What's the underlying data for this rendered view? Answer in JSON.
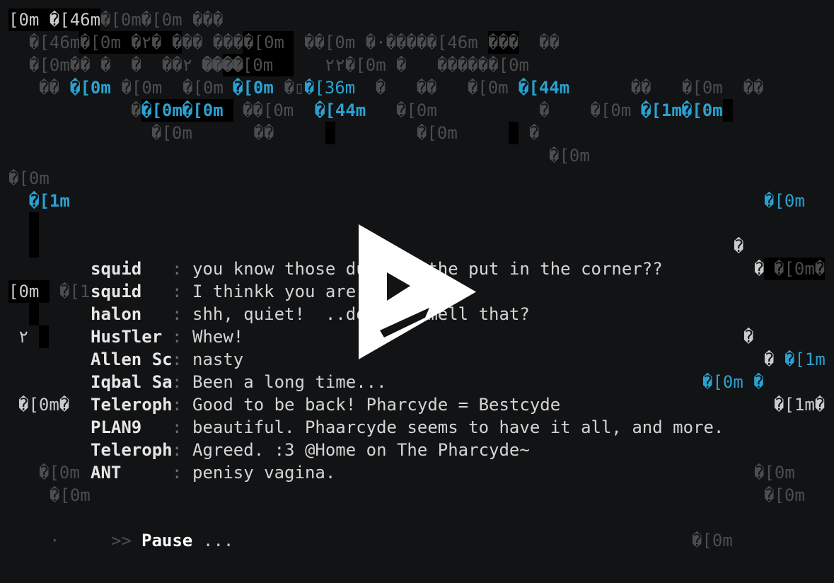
{
  "garble": {
    "r1a": "[0m �[46m",
    "r1b": "�[0m�[0m ���",
    "r2a": "�[46m",
    "r2b": "�[0m �٢� ��� ����[0m",
    "r2c": "��[0m �·�����[46m ",
    "r2d": "���",
    "r2e": "��",
    "r3a": "�[0m�� �  �  ��٢ ����",
    "r3b": "����[0m",
    "r3c": "٢٢�[0m �   ������[0m",
    "r4a": "�� ",
    "r4b": "�[0m",
    "r4c": " �[0m  �[0m ",
    "r4d": "�[0m",
    "r4e": " �▯",
    "r4f": "�[36m",
    "r4g": "  �   ��   �[0m ",
    "r4h": "�[44m",
    "r4i": "      ��   �[0m  ��",
    "r5a": "�",
    "r5b": "�[0m�[0m",
    "r5c": "��[0m  ",
    "r5d": "�[44m",
    "r5e": "�[0m          �    �[0m ",
    "r5f": "�[1m�[0m",
    "r6a": "�[0m      ��",
    "r6b": "�[0m",
    "r6c": "�",
    "r7a": "�[0m",
    "r8a": "�[0m",
    "r9a": "�[1m",
    "r9b": "�[0m",
    "r11a": "�",
    "r12a": "�",
    "r12b": "�[0m�",
    "r13a": "[0m",
    "r13b": "�[1",
    "r15a": "٢",
    "r15b": "�",
    "r16a": "� ",
    "r16b": "�[1m",
    "r17a": "�[0m �",
    "r18a": "�[0m�",
    "r18b": "�[1m�",
    "r20a": "�[0m",
    "r20b": "�[0m",
    "r21a": "�[0m",
    "r21b": "�[0m",
    "r23a": "·",
    "r23b": "�[0m"
  },
  "chat": [
    {
      "name": "squid",
      "message": "you know those dumbies the put in the corner??"
    },
    {
      "name": "squid",
      "message": "I thinkk you are one"
    },
    {
      "name": "halon",
      "message": "shh, quiet!  ..do you smell that?"
    },
    {
      "name": "HusTler",
      "message": "Whew!"
    },
    {
      "name": "Allen Sc",
      "message": "nasty"
    },
    {
      "name": "Iqbal Sa",
      "message": "Been a long time..."
    },
    {
      "name": "Teleroph",
      "message": "Good to be back! Pharcyde = Bestcyde"
    },
    {
      "name": "PLAN9",
      "message": "beautiful. Phaarcyde seems to have it all, and more."
    },
    {
      "name": "Teleroph",
      "message": "Agreed. :3 @Home on The Pharcyde~"
    },
    {
      "name": "ANT",
      "message": "penisy vagina."
    }
  ],
  "separator": ":",
  "prompt": {
    "arrows": ">>",
    "label": "Pause",
    "dots": "..."
  },
  "player": {
    "play_icon": "play-triangle-icon",
    "color": "#ffffff"
  },
  "colors": {
    "background": "#121314",
    "accent": "#2aa1d3",
    "dim": "#4b4d4e"
  }
}
